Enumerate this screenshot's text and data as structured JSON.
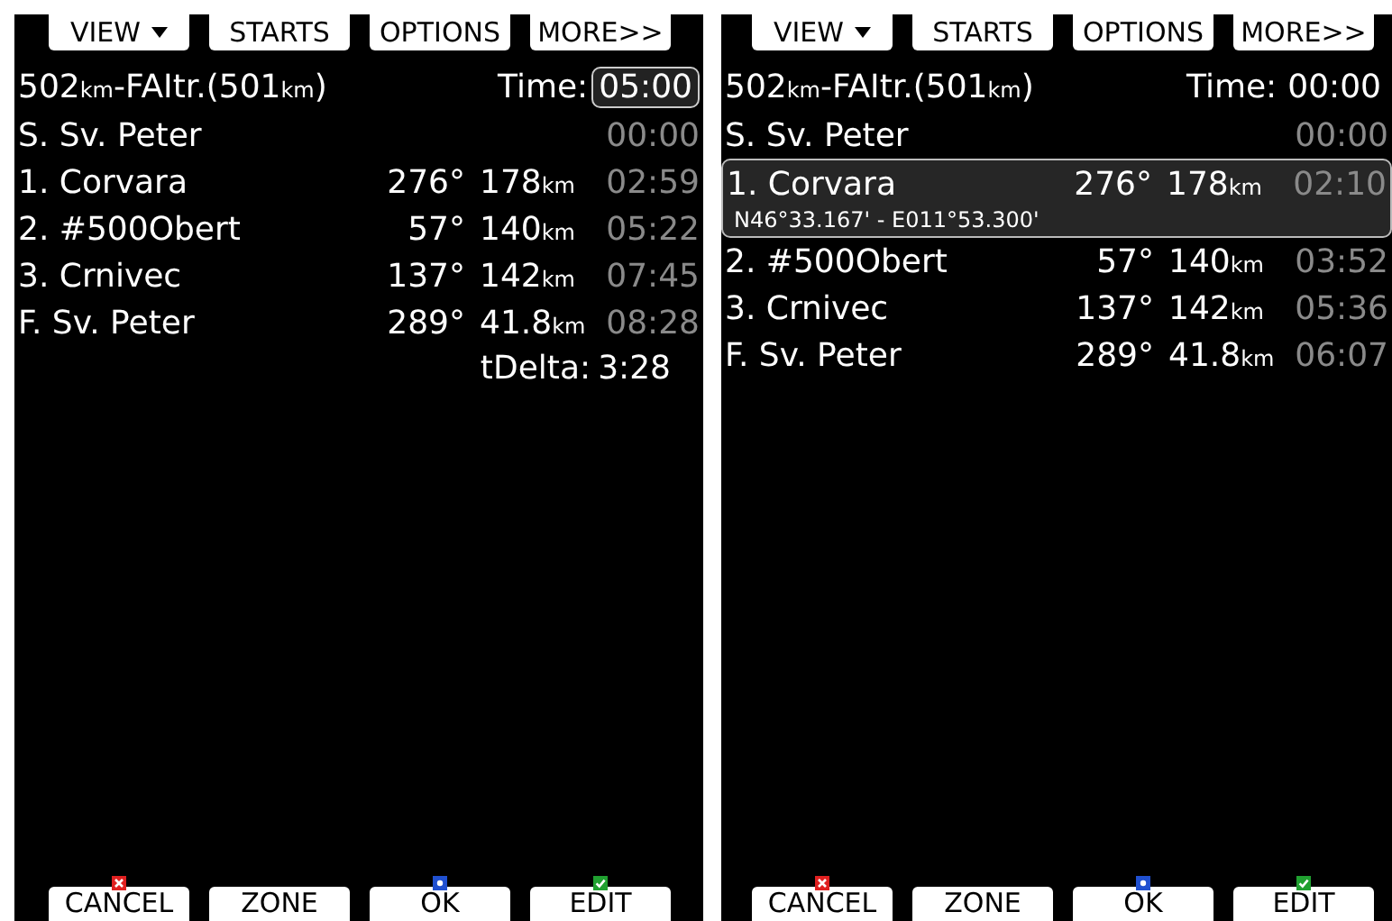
{
  "screens": [
    {
      "tabs": [
        {
          "label": "VIEW",
          "kind": "dropdown"
        },
        {
          "label": "STARTS",
          "kind": "plain"
        },
        {
          "label": "OPTIONS",
          "kind": "plain"
        },
        {
          "label": "MORE>>",
          "kind": "plain"
        }
      ],
      "title_parts": [
        {
          "text": "502",
          "kind": "value"
        },
        {
          "text": "km",
          "kind": "unit"
        },
        {
          "text": "-FAItr.(501",
          "kind": "value"
        },
        {
          "text": "km",
          "kind": "unit"
        },
        {
          "text": ")",
          "kind": "value"
        }
      ],
      "time_label": "Time:",
      "time_value": "05:00",
      "time_selected": true,
      "points": [
        {
          "name": "S. Sv. Peter",
          "time": "00:00",
          "selected": false
        },
        {
          "name": "1. Corvara",
          "bearing": "276°",
          "distance": "178",
          "unit": "km",
          "time": "02:59",
          "selected": false
        },
        {
          "name": "2. #500Obert",
          "bearing": "57°",
          "distance": "140",
          "unit": "km",
          "time": "05:22",
          "selected": false
        },
        {
          "name": "3. Crnivec",
          "bearing": "137°",
          "distance": "142",
          "unit": "km",
          "time": "07:45",
          "selected": false
        },
        {
          "name": "F. Sv. Peter",
          "bearing": "289°",
          "distance": "41.8",
          "unit": "km",
          "time": "08:28",
          "selected": false
        }
      ],
      "delta_label": "tDelta:",
      "delta_value": "3:28",
      "buttons": [
        {
          "label": "CANCEL",
          "kind": "cancel"
        },
        {
          "label": "ZONE",
          "kind": "plain"
        },
        {
          "label": "OK",
          "kind": "ok"
        },
        {
          "label": "EDIT",
          "kind": "edit"
        }
      ]
    },
    {
      "tabs": [
        {
          "label": "VIEW",
          "kind": "dropdown"
        },
        {
          "label": "STARTS",
          "kind": "plain"
        },
        {
          "label": "OPTIONS",
          "kind": "plain"
        },
        {
          "label": "MORE>>",
          "kind": "plain"
        }
      ],
      "title_parts": [
        {
          "text": "502",
          "kind": "value"
        },
        {
          "text": "km",
          "kind": "unit"
        },
        {
          "text": "-FAItr.(501",
          "kind": "value"
        },
        {
          "text": "km",
          "kind": "unit"
        },
        {
          "text": ")",
          "kind": "value"
        }
      ],
      "time_label": "Time:",
      "time_value": "00:00",
      "time_selected": false,
      "points": [
        {
          "name": "S. Sv. Peter",
          "time": "00:00",
          "selected": false
        },
        {
          "name": "1. Corvara",
          "bearing": "276°",
          "distance": "178",
          "unit": "km",
          "time": "02:10",
          "selected": true,
          "coordinates": "N46°33.167' - E011°53.300'"
        },
        {
          "name": "2. #500Obert",
          "bearing": "57°",
          "distance": "140",
          "unit": "km",
          "time": "03:52",
          "selected": false
        },
        {
          "name": "3. Crnivec",
          "bearing": "137°",
          "distance": "142",
          "unit": "km",
          "time": "05:36",
          "selected": false
        },
        {
          "name": "F. Sv. Peter",
          "bearing": "289°",
          "distance": "41.8",
          "unit": "km",
          "time": "06:07",
          "selected": false
        }
      ],
      "buttons": [
        {
          "label": "CANCEL",
          "kind": "cancel"
        },
        {
          "label": "ZONE",
          "kind": "plain"
        },
        {
          "label": "OK",
          "kind": "ok"
        },
        {
          "label": "EDIT",
          "kind": "edit"
        }
      ]
    }
  ]
}
